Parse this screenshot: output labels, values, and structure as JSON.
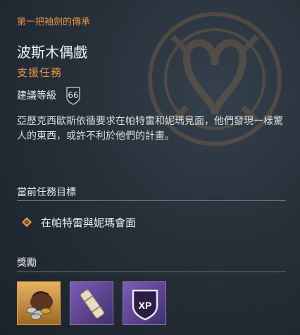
{
  "quest": {
    "chapter": "第一把袖劍的傳承",
    "title": "波斯木偶戲",
    "type": "支援任務",
    "level_label": "建議等級",
    "level": "66",
    "description": "亞歷克西歐斯依循要求在帕特雷和妮瑪見面，他們發現一樣驚人的東西，或許不利於他們的計畫。"
  },
  "objectives": {
    "title": "當前任務目標",
    "items": [
      {
        "text": "在帕特雷與妮瑪會面"
      }
    ]
  },
  "rewards": {
    "title": "獎勵",
    "items": [
      {
        "icon": "drachmae-pouch-icon",
        "rarity": "legendary",
        "color": "#c98a2c"
      },
      {
        "icon": "scroll-icon",
        "rarity": "epic",
        "color": "#6a4fa0"
      },
      {
        "icon": "xp-icon",
        "label": "XP",
        "rarity": "epic",
        "color": "#6a4fa0"
      }
    ]
  },
  "colors": {
    "accent": "#e6924a",
    "background": "#263039",
    "divider": "#6b7580"
  }
}
